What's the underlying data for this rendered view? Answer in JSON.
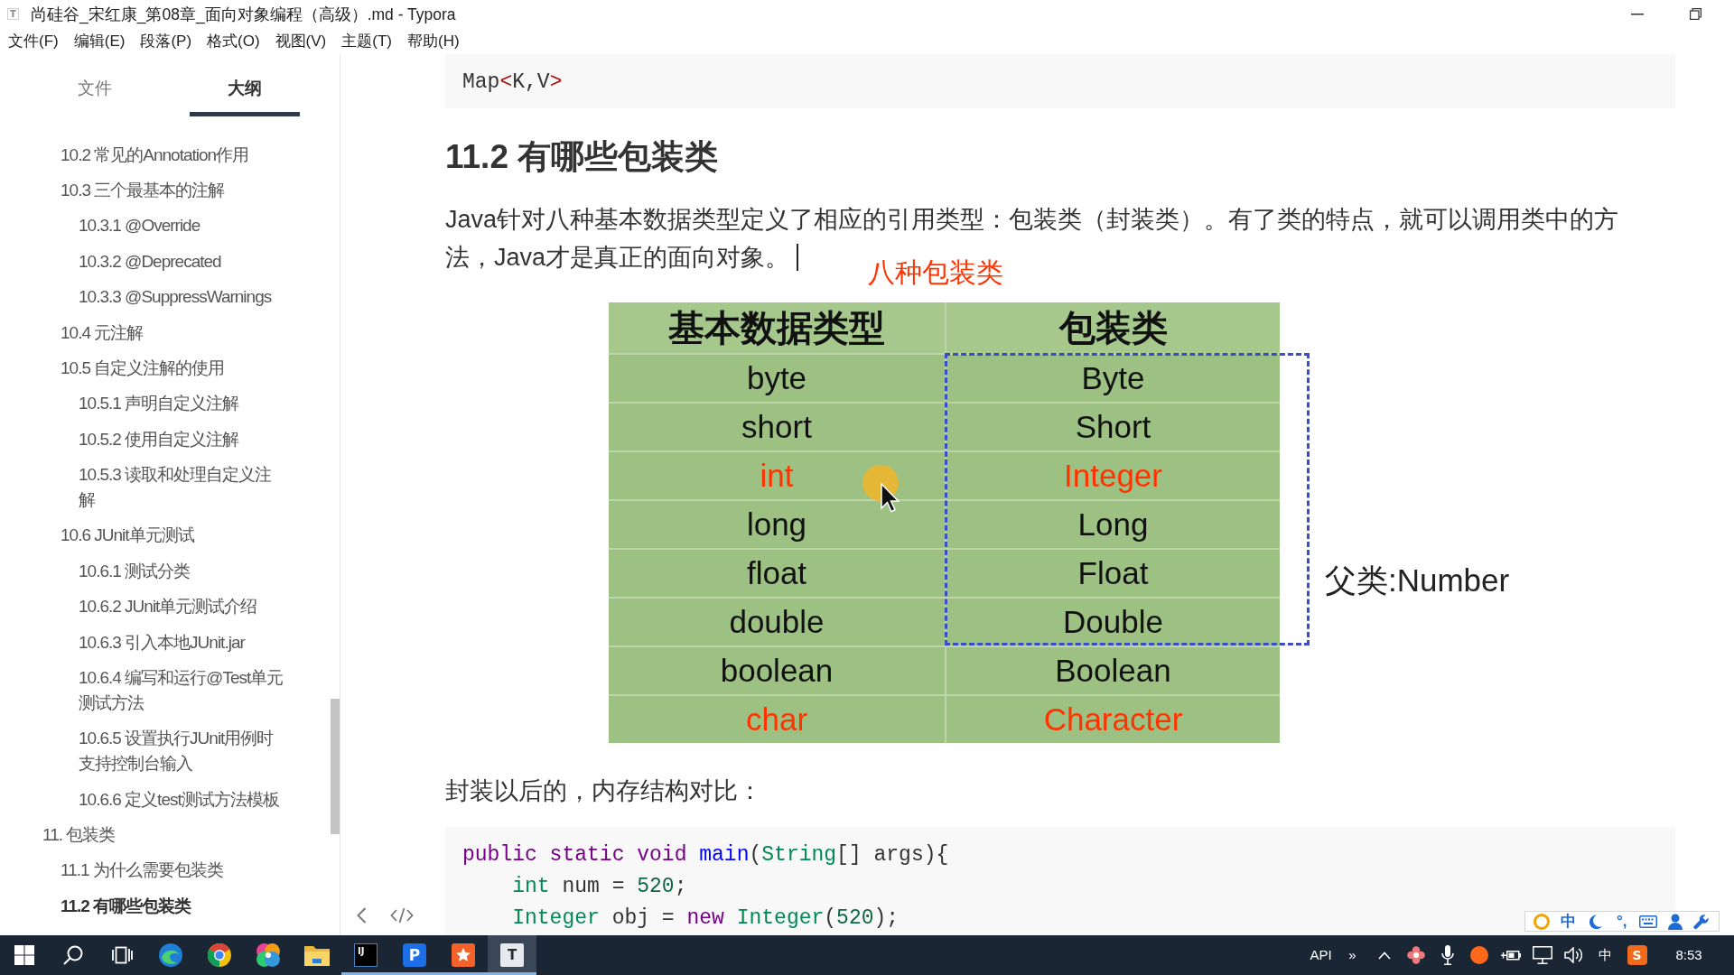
{
  "window": {
    "icon": "T",
    "title": "尚硅谷_宋红康_第08章_面向对象编程（高级）.md - Typora"
  },
  "menu": [
    "文件(F)",
    "编辑(E)",
    "段落(P)",
    "格式(O)",
    "视图(V)",
    "主题(T)",
    "帮助(H)"
  ],
  "sidebar": {
    "tabs": [
      {
        "label": "文件",
        "selected": false
      },
      {
        "label": "大纲",
        "selected": true
      }
    ],
    "outline": [
      {
        "children": [
          {
            "label": "10.2 常见的Annotation作用",
            "selected": false
          },
          {
            "label": "10.3 三个最基本的注解",
            "selected": false,
            "children": [
              {
                "label": "10.3.1 @Override",
                "selected": false
              },
              {
                "label": "10.3.2 @Deprecated",
                "selected": false
              },
              {
                "label": "10.3.3 @SuppressWarnings",
                "selected": false
              }
            ]
          },
          {
            "label": "10.4 元注解",
            "selected": false
          },
          {
            "label": "10.5 自定义注解的使用",
            "selected": false,
            "children": [
              {
                "label": "10.5.1 声明自定义注解",
                "selected": false
              },
              {
                "label": "10.5.2 使用自定义注解",
                "selected": false
              },
              {
                "label": "10.5.3 读取和处理自定义注解",
                "selected": false
              }
            ]
          },
          {
            "label": "10.6 JUnit单元测试",
            "selected": false,
            "children": [
              {
                "label": "10.6.1 测试分类",
                "selected": false
              },
              {
                "label": "10.6.2 JUnit单元测试介绍",
                "selected": false
              },
              {
                "label": "10.6.3 引入本地JUnit.jar",
                "selected": false
              },
              {
                "label": "10.6.4 编写和运行@Test单元测试方法",
                "selected": false
              },
              {
                "label": "10.6.5 设置执行JUnit用例时支持控制台输入",
                "selected": false
              },
              {
                "label": "10.6.6 定义test测试方法模板",
                "selected": false
              }
            ]
          }
        ]
      },
      {
        "label": "11. 包装类",
        "selected": false,
        "children": [
          {
            "label": "11.1 为什么需要包装类",
            "selected": false
          },
          {
            "label": "11.2 有哪些包装类",
            "selected": true
          }
        ]
      }
    ]
  },
  "editor": {
    "blocks": [
      {
        "kind": "code",
        "lines": [
          {
            "tokens": [
              {
                "text": "Map",
                "kind": "plain"
              },
              {
                "text": "<",
                "kind": "angle"
              },
              {
                "text": "K,V",
                "kind": "plain"
              },
              {
                "text": ">",
                "kind": "angle"
              }
            ]
          }
        ]
      },
      {
        "kind": "heading",
        "text": "11.2 有哪些包装类"
      },
      {
        "kind": "paragraph",
        "text": "Java针对八种基本数据类型定义了相应的引用类型：包装类（封装类）。有了类的特点，就可以调用类中的方法，Java才是真正的面向对象。",
        "caret": true
      },
      {
        "kind": "figure",
        "caption": "八种包装类",
        "columns": [
          "基本数据类型",
          "包装类"
        ],
        "rows": [
          {
            "kind": "group",
            "label": "父类:Number",
            "rows": [
              {
                "cells": [
                  "byte",
                  "Byte"
                ],
                "highlighted": false
              },
              {
                "cells": [
                  "short",
                  "Short"
                ],
                "highlighted": false
              },
              {
                "cells": [
                  "int",
                  "Integer"
                ],
                "highlighted": true
              },
              {
                "cells": [
                  "long",
                  "Long"
                ],
                "highlighted": false
              },
              {
                "cells": [
                  "float",
                  "Float"
                ],
                "highlighted": false
              },
              {
                "cells": [
                  "double",
                  "Double"
                ],
                "highlighted": false
              }
            ]
          },
          {
            "kind": "row",
            "cells": [
              "boolean",
              "Boolean"
            ],
            "highlighted": false
          },
          {
            "kind": "row",
            "cells": [
              "char",
              "Character"
            ],
            "highlighted": true
          }
        ]
      },
      {
        "kind": "paragraph",
        "text": "封装以后的，内存结构对比：",
        "caret": false
      },
      {
        "kind": "code",
        "lines": [
          {
            "tokens": [
              {
                "text": "public static void ",
                "kind": "keyword"
              },
              {
                "text": "main",
                "kind": "def"
              },
              {
                "text": "(",
                "kind": "plain"
              },
              {
                "text": "String",
                "kind": "type"
              },
              {
                "text": "[] args){",
                "kind": "plain"
              }
            ]
          },
          {
            "tokens": [
              {
                "text": "    int",
                "kind": "type"
              },
              {
                "text": " num = ",
                "kind": "plain"
              },
              {
                "text": "520",
                "kind": "number"
              },
              {
                "text": ";",
                "kind": "plain"
              }
            ]
          },
          {
            "tokens": [
              {
                "text": "    Integer",
                "kind": "type"
              },
              {
                "text": " obj = ",
                "kind": "plain"
              },
              {
                "text": "new",
                "kind": "keyword"
              },
              {
                "text": " Integer",
                "kind": "type"
              },
              {
                "text": "(",
                "kind": "plain"
              },
              {
                "text": "520",
                "kind": "number"
              },
              {
                "text": ");",
                "kind": "plain"
              }
            ]
          }
        ]
      }
    ]
  },
  "taskbar": {
    "apps": [
      {
        "kind": "windows",
        "running": false,
        "active": false
      },
      {
        "kind": "search",
        "running": false,
        "active": false
      },
      {
        "kind": "taskview",
        "running": false,
        "active": false
      },
      {
        "kind": "swirl",
        "running": false,
        "active": false
      },
      {
        "kind": "ring",
        "running": false,
        "active": false
      },
      {
        "kind": "pinwheel",
        "running": false,
        "active": false
      },
      {
        "kind": "folder",
        "running": false,
        "active": false
      },
      {
        "kind": "dark-tile",
        "glyph": "IJ",
        "running": true,
        "active": false
      },
      {
        "kind": "blue-tile",
        "glyph": "P",
        "running": true,
        "active": false
      },
      {
        "kind": "star-tile",
        "running": true,
        "active": false
      },
      {
        "kind": "doc-tile",
        "glyph": "T",
        "running": true,
        "active": true
      }
    ],
    "tray": [
      {
        "kind": "text",
        "text": "API"
      },
      {
        "kind": "text",
        "text": "»"
      },
      {
        "kind": "chevron"
      },
      {
        "kind": "flower"
      },
      {
        "kind": "mic"
      },
      {
        "kind": "circle"
      },
      {
        "kind": "battery"
      },
      {
        "kind": "monitor"
      },
      {
        "kind": "speaker"
      },
      {
        "kind": "text",
        "text": "中"
      },
      {
        "kind": "letter-tile",
        "glyph": "S"
      }
    ],
    "clock": "8:53"
  },
  "ime_toolbar": [
    {
      "kind": "ring"
    },
    {
      "kind": "text",
      "text": "中"
    },
    {
      "kind": "moon"
    },
    {
      "kind": "text",
      "text": "°,"
    },
    {
      "kind": "keyboard"
    },
    {
      "kind": "person"
    },
    {
      "kind": "wrench"
    }
  ]
}
